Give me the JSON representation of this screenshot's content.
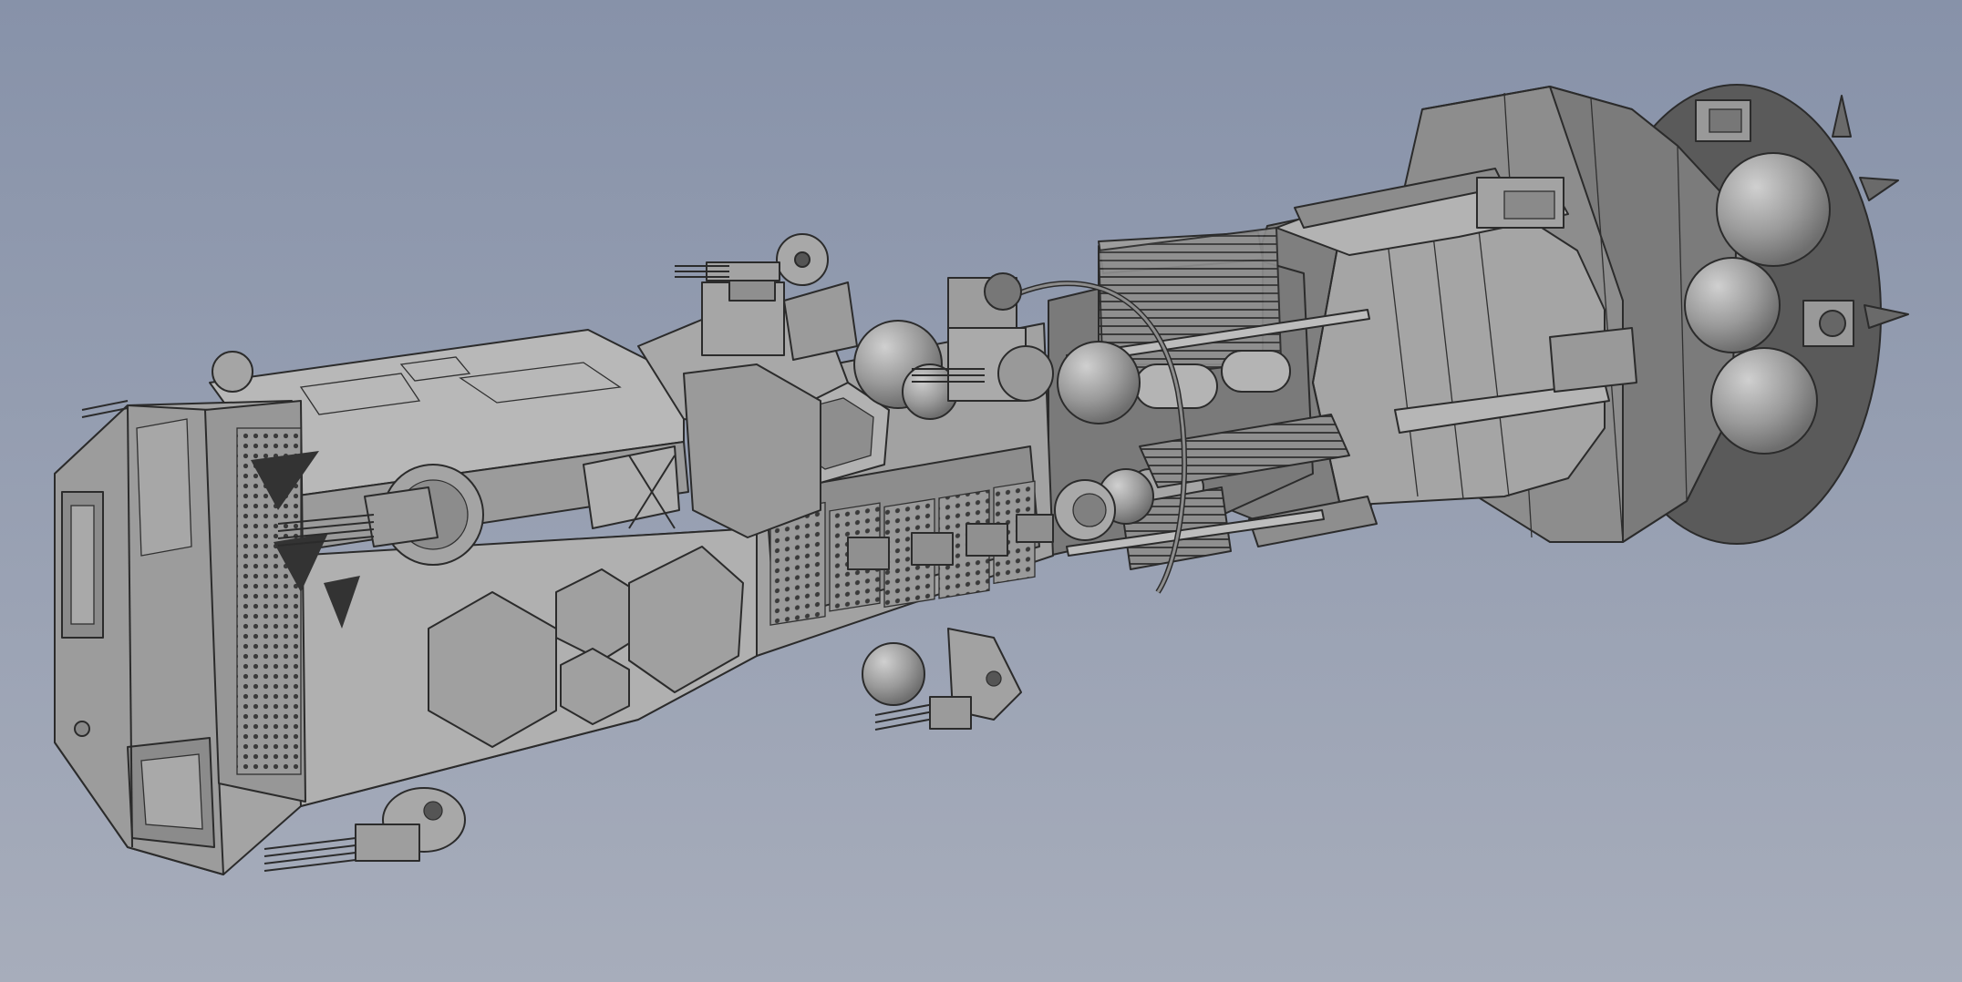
{
  "viewport": {
    "background_top": "#8792a9",
    "background_bottom": "#a7adbb",
    "model_face_light": "#a9a9a9",
    "model_face_mid": "#8e8e8e",
    "model_face_dark": "#6a6a6a",
    "edge_color": "#2b2b2b"
  }
}
